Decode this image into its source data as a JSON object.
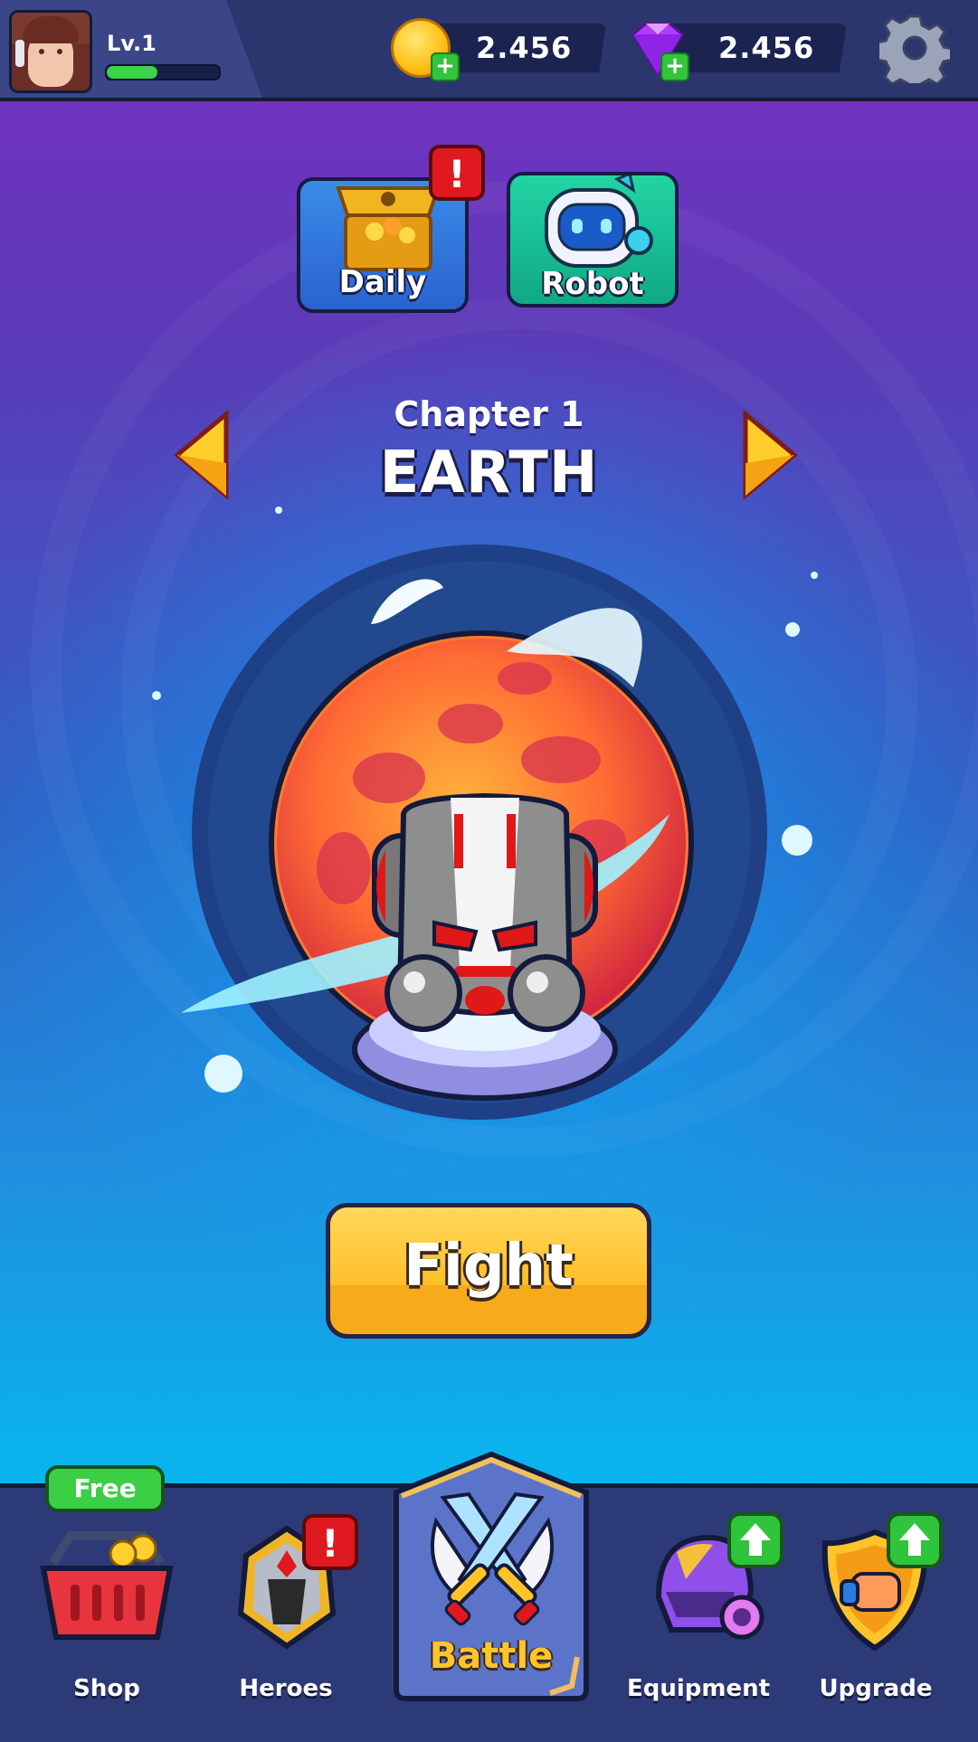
{
  "header": {
    "level_label": "Lv.1",
    "xp_progress": 0.45,
    "coins": "2.456",
    "gems": "2.456"
  },
  "quick_tiles": {
    "daily_label": "Daily",
    "daily_alert": "!",
    "robot_label": "Robot"
  },
  "chapter": {
    "label": "Chapter 1",
    "name": "EARTH"
  },
  "fight_label": "Fight",
  "bottom_nav": {
    "shop_label": "Shop",
    "shop_badge": "Free",
    "heroes_label": "Heroes",
    "heroes_alert": "!",
    "battle_label": "Battle",
    "equipment_label": "Equipment",
    "upgrade_label": "Upgrade"
  },
  "colors": {
    "coin": "#ffc21a",
    "gem": "#b03cff",
    "alert": "#e0181f",
    "positive": "#2fc43b",
    "fight_button": "#ffbf2a",
    "battle_text": "#ffc42a"
  },
  "icons": [
    "avatar",
    "coin-icon",
    "gem-icon",
    "plus-icon",
    "gear-icon",
    "treasure-chest-icon",
    "robot-icon",
    "arrow-left-icon",
    "arrow-right-icon",
    "basket-icon",
    "helmet-icon",
    "crossed-swords-icon",
    "visor-helmet-icon",
    "shield-fist-icon",
    "arrow-up-icon"
  ]
}
